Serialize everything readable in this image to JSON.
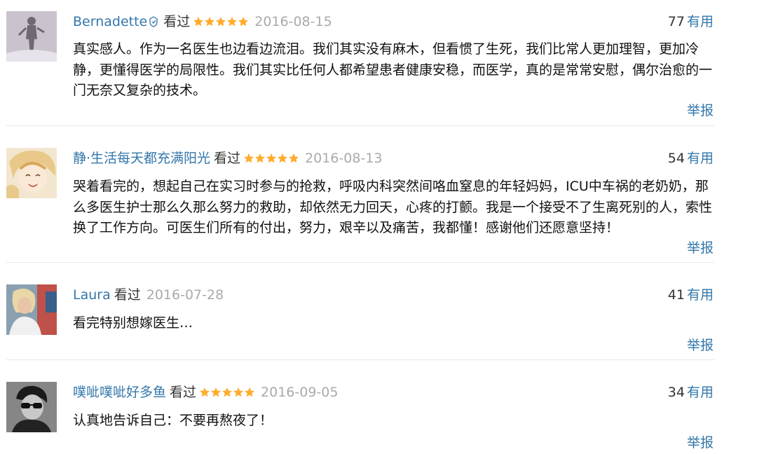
{
  "reviews": [
    {
      "username": "Bernadette",
      "verified_icon": "verified-badge-icon",
      "watched_label": "看过",
      "rating_stars": 5,
      "date": "2016-08-15",
      "vote_count": "77",
      "useful_label": "有用",
      "content": "真实感人。作为一名医生也边看边流泪。我们其实没有麻木，但看惯了生死，我们比常人更加理智，更加冷静，更懂得医学的局限性。我们其实比任何人都希望患者健康安稳，而医学，真的是常常安慰，偶尔治愈的一门无奈又复杂的技术。",
      "report_label": "举报"
    },
    {
      "username": "静·生活每天都充满阳光",
      "watched_label": "看过",
      "rating_stars": 5,
      "date": "2016-08-13",
      "vote_count": "54",
      "useful_label": "有用",
      "content": "哭着看完的，想起自己在实习时参与的抢救，呼吸内科突然间咯血窒息的年轻妈妈，ICU中车祸的老奶奶，那么多医生护士那么久那么努力的救助，却依然无力回天，心疼的打颤。我是一个接受不了生离死别的人，索性换了工作方向。可医生们所有的付出，努力，艰辛以及痛苦，我都懂！感谢他们还愿意坚持！",
      "report_label": "举报"
    },
    {
      "username": "Laura",
      "watched_label": "看过",
      "rating_stars": 0,
      "date": "2016-07-28",
      "vote_count": "41",
      "useful_label": "有用",
      "content": "看完特别想嫁医生…",
      "report_label": "举报"
    },
    {
      "username": "噗呲噗呲好多鱼",
      "watched_label": "看过",
      "rating_stars": 5,
      "date": "2016-09-05",
      "vote_count": "34",
      "useful_label": "有用",
      "content": "认真地告诉自己：不要再熬夜了！",
      "report_label": "举报"
    }
  ],
  "colors": {
    "link": "#3377aa",
    "star": "#ffac2d",
    "date": "#aaaaaa",
    "divider": "#e8e8e8"
  }
}
